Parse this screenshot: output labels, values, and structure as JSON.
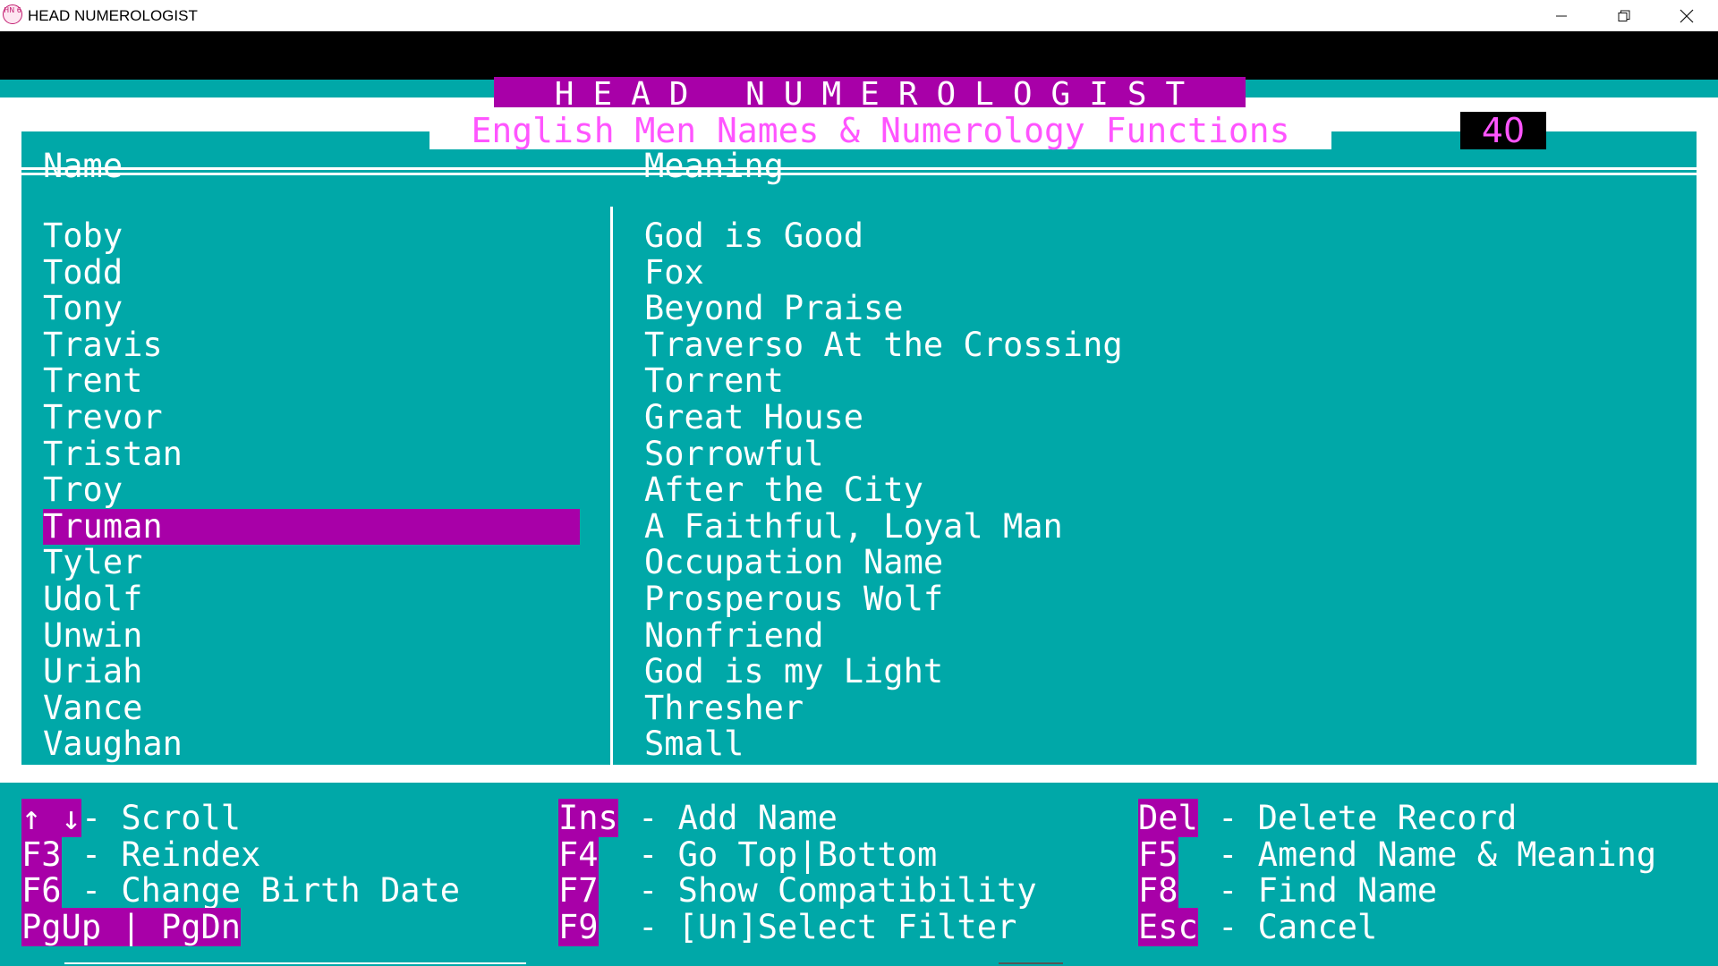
{
  "window": {
    "title": "HEAD NUMEROLOGIST",
    "icon_label": "HN 6",
    "buttons": [
      "minimize-icon",
      "restore-icon",
      "close-icon"
    ]
  },
  "app": {
    "banner": "HEAD NUMEROLOGIST",
    "subtitle": "English Men Names & Numerology Functions",
    "record_count": "40"
  },
  "table": {
    "headers": {
      "name": "Name",
      "meaning": "Meaning"
    },
    "selected_name": "Truman",
    "rows": [
      {
        "name": "Toby",
        "meaning": "God is Good"
      },
      {
        "name": "Todd",
        "meaning": "Fox"
      },
      {
        "name": "Tony",
        "meaning": "Beyond Praise"
      },
      {
        "name": "Travis",
        "meaning": "Traverso At the Crossing"
      },
      {
        "name": "Trent",
        "meaning": "Torrent"
      },
      {
        "name": "Trevor",
        "meaning": "Great House"
      },
      {
        "name": "Tristan",
        "meaning": "Sorrowful"
      },
      {
        "name": "Troy",
        "meaning": "After the City"
      },
      {
        "name": "Truman",
        "meaning": "A Faithful, Loyal Man"
      },
      {
        "name": "Tyler",
        "meaning": "Occupation Name"
      },
      {
        "name": "Udolf",
        "meaning": "Prosperous Wolf"
      },
      {
        "name": "Unwin",
        "meaning": "Nonfriend"
      },
      {
        "name": "Uriah",
        "meaning": "God is my Light"
      },
      {
        "name": "Vance",
        "meaning": "Thresher"
      },
      {
        "name": "Vaughan",
        "meaning": "Small"
      }
    ]
  },
  "functions": [
    {
      "key": "↑ ↓",
      "sep": "- ",
      "label": "Scroll"
    },
    {
      "key": "F3",
      "sep": " - ",
      "label": "Reindex"
    },
    {
      "key": "F6",
      "sep": " - ",
      "label": "Change Birth Date"
    },
    {
      "key": "PgUp | PgDn",
      "sep": "",
      "label": ""
    },
    {
      "key": "Ins",
      "sep": " - ",
      "label": "Add Name"
    },
    {
      "key": "F4",
      "sep": "  - ",
      "label": "Go Top|Bottom"
    },
    {
      "key": "F7",
      "sep": "  - ",
      "label": "Show Compatibility"
    },
    {
      "key": "F9",
      "sep": "  - ",
      "label": "[Un]Select Filter"
    },
    {
      "key": "Del",
      "sep": " - ",
      "label": "Delete Record"
    },
    {
      "key": "F5",
      "sep": "  - ",
      "label": "Amend Name & Meaning"
    },
    {
      "key": "F8",
      "sep": "  - ",
      "label": "Find Name"
    },
    {
      "key": "Esc",
      "sep": " - ",
      "label": "Cancel"
    }
  ],
  "colors": {
    "teal": "#00a8a8",
    "magenta": "#a800a8",
    "pink_text": "#ff55ff",
    "white": "#ffffff",
    "black": "#000000"
  }
}
